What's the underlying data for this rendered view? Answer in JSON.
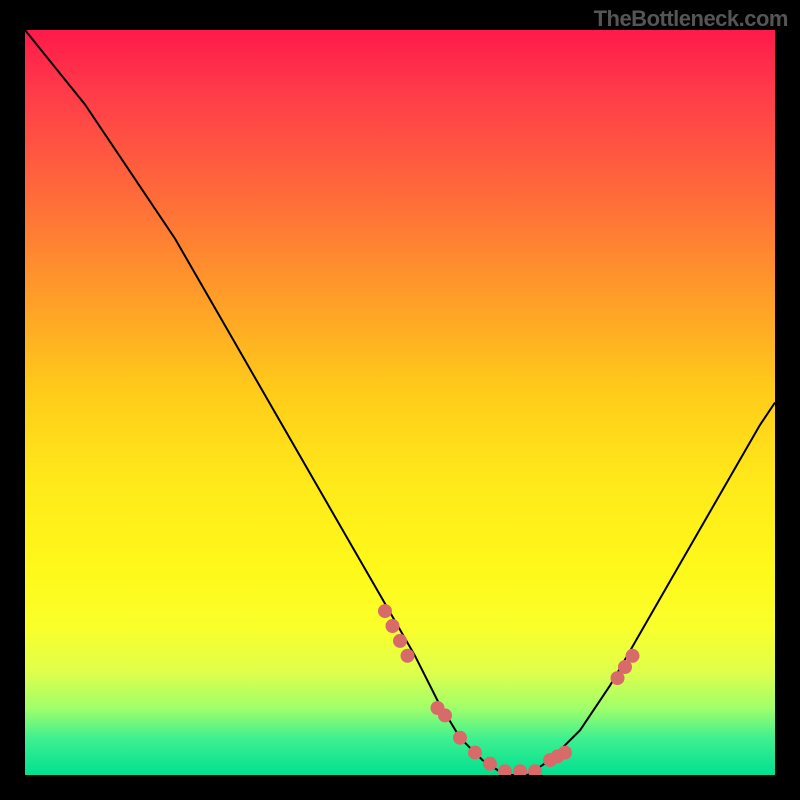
{
  "attribution": "TheBottleneck.com",
  "chart_data": {
    "type": "line",
    "title": "",
    "xlabel": "",
    "ylabel": "",
    "ylim": [
      0,
      100
    ],
    "xlim": [
      0,
      100
    ],
    "series": [
      {
        "name": "bottleneck-curve",
        "x": [
          0,
          4,
          8,
          12,
          16,
          20,
          24,
          28,
          32,
          36,
          40,
          44,
          48,
          52,
          55,
          58,
          61,
          64,
          67,
          70,
          74,
          78,
          82,
          86,
          90,
          94,
          98,
          100
        ],
        "y": [
          100,
          95,
          90,
          84,
          78,
          72,
          65,
          58,
          51,
          44,
          37,
          30,
          23,
          16,
          10,
          5,
          2,
          0,
          0,
          2,
          6,
          12,
          19,
          26,
          33,
          40,
          47,
          50
        ]
      }
    ],
    "points": {
      "name": "highlight-points",
      "color": "#d86a6a",
      "x": [
        48,
        49,
        50,
        51,
        55,
        56,
        58,
        60,
        62,
        64,
        66,
        68,
        70,
        71,
        72,
        79,
        80,
        81
      ],
      "y": [
        22,
        20,
        18,
        16,
        9,
        8,
        5,
        3,
        1.5,
        0.5,
        0.5,
        0.5,
        2,
        2.5,
        3,
        13,
        14.5,
        16
      ]
    },
    "gradient_stops": [
      {
        "pos": 0,
        "color": "#ff1a4a"
      },
      {
        "pos": 8,
        "color": "#ff3a4a"
      },
      {
        "pos": 22,
        "color": "#ff6a3a"
      },
      {
        "pos": 35,
        "color": "#ff9a2a"
      },
      {
        "pos": 48,
        "color": "#ffca1a"
      },
      {
        "pos": 60,
        "color": "#ffe81a"
      },
      {
        "pos": 72,
        "color": "#fff81a"
      },
      {
        "pos": 80,
        "color": "#faff2a"
      },
      {
        "pos": 86,
        "color": "#e0ff4a"
      },
      {
        "pos": 91,
        "color": "#a0ff6a"
      },
      {
        "pos": 95,
        "color": "#40f090"
      },
      {
        "pos": 100,
        "color": "#00e090"
      }
    ]
  }
}
